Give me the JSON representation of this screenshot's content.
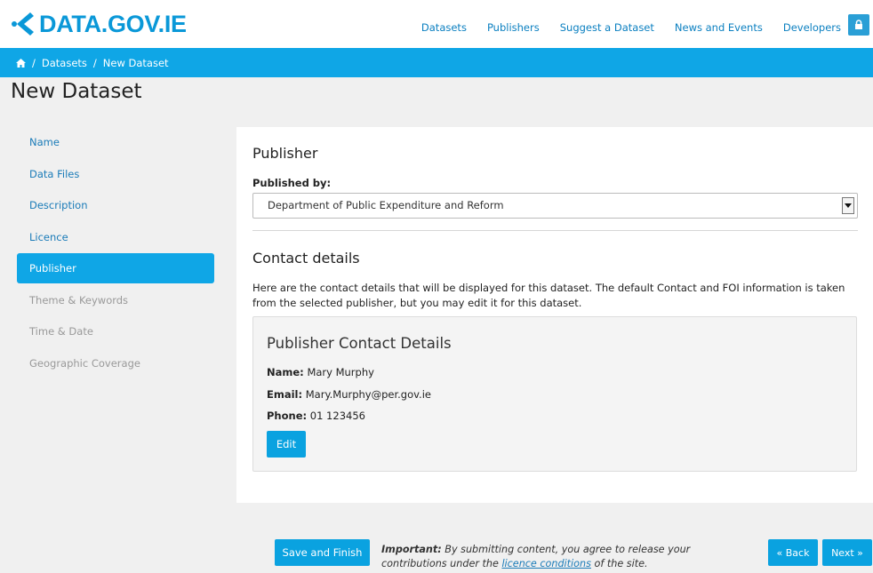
{
  "brand": {
    "logo_text": "DATA.GOV.IE"
  },
  "nav": {
    "items": [
      "Datasets",
      "Publishers",
      "Suggest a Dataset",
      "News and Events",
      "Developers"
    ]
  },
  "breadcrumb": {
    "items": [
      "Datasets",
      "New Dataset"
    ],
    "separator": "/"
  },
  "page": {
    "title": "New Dataset"
  },
  "sidebar": {
    "items": [
      {
        "label": "Name",
        "state": "link"
      },
      {
        "label": "Data Files",
        "state": "link"
      },
      {
        "label": "Description",
        "state": "link"
      },
      {
        "label": "Licence",
        "state": "link"
      },
      {
        "label": "Publisher",
        "state": "active"
      },
      {
        "label": "Theme & Keywords",
        "state": "disabled"
      },
      {
        "label": "Time & Date",
        "state": "disabled"
      },
      {
        "label": "Geographic Coverage",
        "state": "disabled"
      }
    ]
  },
  "publisher": {
    "heading": "Publisher",
    "published_by_label": "Published by:",
    "selected": "Department of Public Expenditure and Reform"
  },
  "contact": {
    "heading": "Contact details",
    "description": "Here are the contact details that will be displayed for this dataset. The default Contact and FOI information is taken from the selected publisher, but you may edit it for this dataset.",
    "card_title": "Publisher Contact Details",
    "name_label": "Name:",
    "name_value": "Mary Murphy",
    "email_label": "Email:",
    "email_value": "Mary.Murphy@per.gov.ie",
    "phone_label": "Phone:",
    "phone_value": "01 123456",
    "edit_label": "Edit"
  },
  "footer": {
    "save_label": "Save and Finish",
    "important_label": "Important:",
    "important_text_1": "By submitting content, you agree to release your contributions under the",
    "important_link": "licence conditions",
    "important_text_2": "of the site.",
    "back_label": "« Back",
    "next_label": "Next »"
  },
  "colors": {
    "brand": "#0a98d8",
    "breadcrumb_bg": "#0fa6e6",
    "button": "#0aa2e0",
    "page_bg": "#f0f0f0"
  },
  "icons": {
    "home": "home-icon",
    "lock": "lock-icon",
    "dropdown": "caret-down-icon"
  }
}
